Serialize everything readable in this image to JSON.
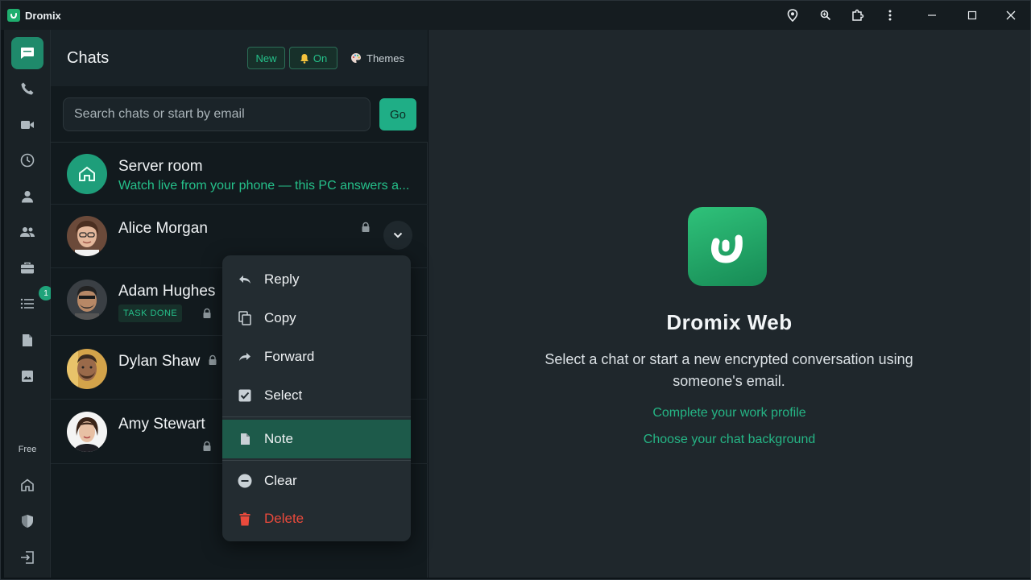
{
  "app": {
    "title": "Dromix",
    "accent": "#1fae86",
    "danger": "#ea4a3c"
  },
  "titlebar": {
    "icons": [
      "location-pin-icon",
      "zoom-icon",
      "extension-icon",
      "more-vert-icon",
      "minimize-icon",
      "maximize-icon",
      "close-icon"
    ]
  },
  "rail": {
    "items": [
      "chat-icon",
      "phone-icon",
      "video-icon",
      "history-icon",
      "person-icon",
      "group-icon",
      "briefcase-icon",
      "list-icon",
      "document-icon",
      "image-icon"
    ],
    "list_badge": "1",
    "plan_label": "Free",
    "bottom": [
      "home-icon",
      "shield-icon",
      "logout-icon"
    ]
  },
  "chats": {
    "title": "Chats",
    "new_label": "New",
    "notify_label": "On",
    "themes_label": "Themes",
    "search_placeholder": "Search chats or start by email",
    "go_label": "Go",
    "items": [
      {
        "name": "Server room",
        "subtitle": "Watch live from your phone — this PC answers a..."
      },
      {
        "name": "Alice Morgan",
        "locked": true
      },
      {
        "name": "Adam Hughes",
        "badge": "TASK DONE",
        "locked": true
      },
      {
        "name": "Dylan Shaw",
        "locked": true
      },
      {
        "name": "Amy Stewart",
        "locked": true
      }
    ]
  },
  "context_menu": {
    "items": [
      {
        "label": "Reply",
        "icon": "reply-icon"
      },
      {
        "label": "Copy",
        "icon": "copy-icon"
      },
      {
        "label": "Forward",
        "icon": "forward-icon"
      },
      {
        "label": "Select",
        "icon": "checkbox-icon"
      },
      {
        "label": "Note",
        "icon": "note-icon",
        "highlighted": true
      },
      {
        "label": "Clear",
        "icon": "clear-icon"
      },
      {
        "label": "Delete",
        "icon": "trash-icon",
        "danger": true
      }
    ]
  },
  "welcome": {
    "title": "Dromix Web",
    "text": "Select a chat or start a new encrypted conversation using someone's email.",
    "link_profile": "Complete your work profile",
    "link_background": "Choose your chat background"
  }
}
